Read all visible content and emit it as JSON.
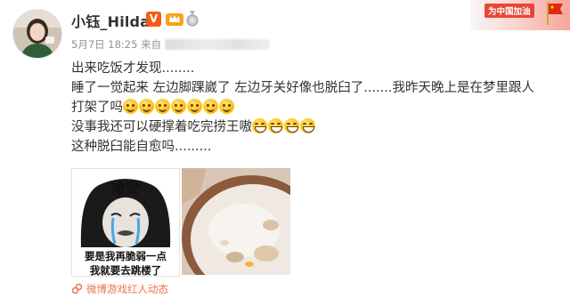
{
  "user": {
    "name": "小钰_Hilda",
    "vip_badge": "V"
  },
  "meta": {
    "date": "5月7日",
    "time": "18:25",
    "source_prefix": "来自"
  },
  "banner": {
    "text": "为中国加油"
  },
  "post": {
    "lines": [
      "出来吃饭才发现........",
      "睡了一觉起来 左边脚踝崴了 左边牙关好像也脱臼了.......我昨天晚上是在梦里跟人",
      "打架了吗",
      "没事我还可以硬撑着吃完捞王嗷",
      "这种脱臼能自愈吗........."
    ]
  },
  "images": {
    "meme": {
      "top_text": "难受",
      "caption_line1": "要是我再脆弱一点",
      "caption_line2": "我就要去跳楼了"
    }
  },
  "footer": {
    "topic": "微博游戏红人动态"
  },
  "colors": {
    "link_orange": "#eb7350",
    "meta_gray": "#939393",
    "text": "#333333"
  }
}
